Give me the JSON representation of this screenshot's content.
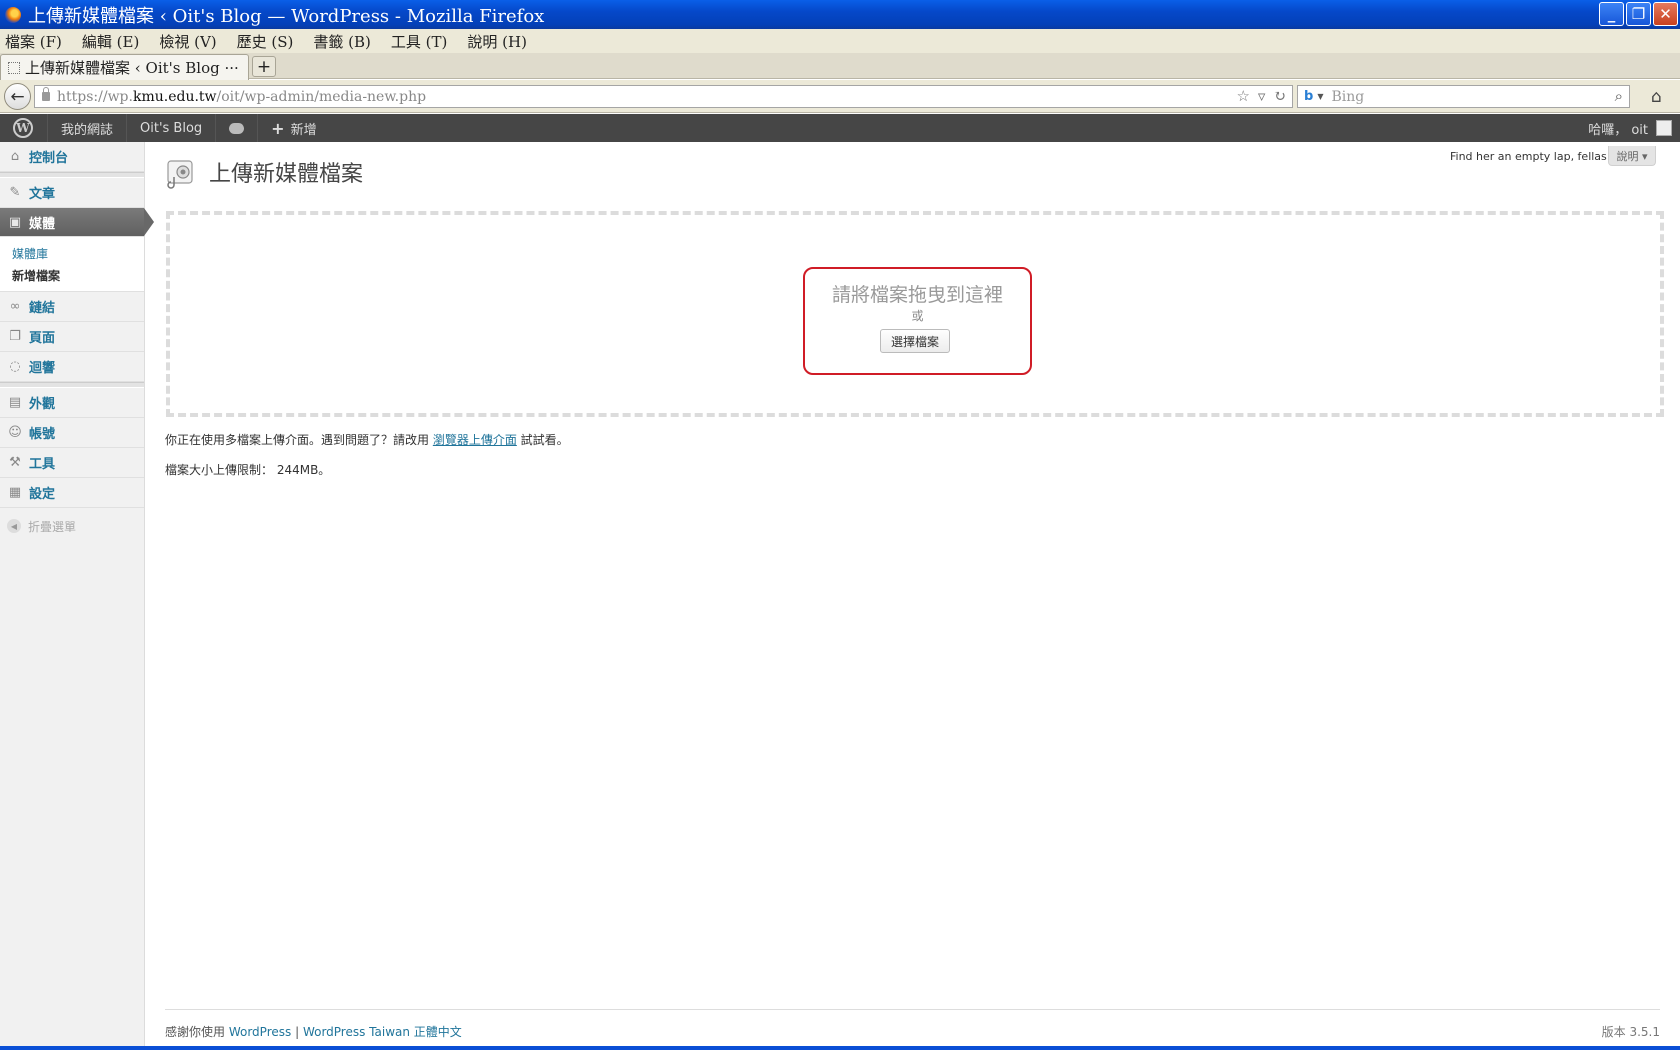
{
  "window": {
    "title": "上傳新媒體檔案 ‹ Oit's Blog — WordPress - Mozilla Firefox",
    "buttons": {
      "minimize": "_",
      "maximize": "❐",
      "close": "✕"
    }
  },
  "menubar": {
    "items": [
      "檔案 (F)",
      "編輯 (E)",
      "檢視 (V)",
      "歷史 (S)",
      "書籤 (B)",
      "工具 (T)",
      "說明 (H)"
    ]
  },
  "tab": {
    "label": "上傳新媒體檔案 ‹ Oit's Blog ···",
    "new_tab": "+"
  },
  "navbar": {
    "url_prefix": "https://wp.",
    "url_host": "kmu.edu.tw",
    "url_path": "/oit/wp-admin/media-new.php",
    "search_placeholder": "Bing"
  },
  "adminbar": {
    "my_sites": "我的網誌",
    "site_name": "Oit's Blog",
    "new": "新增",
    "greeting": "哈囉， oit"
  },
  "sidebar": {
    "dashboard": "控制台",
    "posts": "文章",
    "media": "媒體",
    "media_library": "媒體庫",
    "add_new": "新增檔案",
    "links": "鏈結",
    "pages": "頁面",
    "comments": "迴響",
    "appearance": "外觀",
    "users": "帳號",
    "tools": "工具",
    "settings": "設定",
    "collapse": "折疊選單"
  },
  "content": {
    "page_title": "上傳新媒體檔案",
    "sponsor_text": "Find her an empty lap, fellas",
    "help_tab": "說明 ▾",
    "drop_instructions": "請將檔案拖曳到這裡",
    "or": "或",
    "select_files": "選擇檔案",
    "multi_note_before": "你正在使用多檔案上傳介面。遇到問題了？請改用 ",
    "multi_note_link": "瀏覽器上傳介面",
    "multi_note_after": " 試試看。",
    "size_limit": "檔案大小上傳限制： 244MB。"
  },
  "footer": {
    "thanks_prefix": "感謝你使用 ",
    "wordpress_link": "WordPress",
    "separator": " | ",
    "taiwan_link": "WordPress Taiwan 正體中文",
    "version": "版本 3.5.1"
  },
  "colors": {
    "link": "#21759b",
    "admin_bar": "#464646",
    "highlight": "#d01c26",
    "title_bar": "#0548c9"
  }
}
